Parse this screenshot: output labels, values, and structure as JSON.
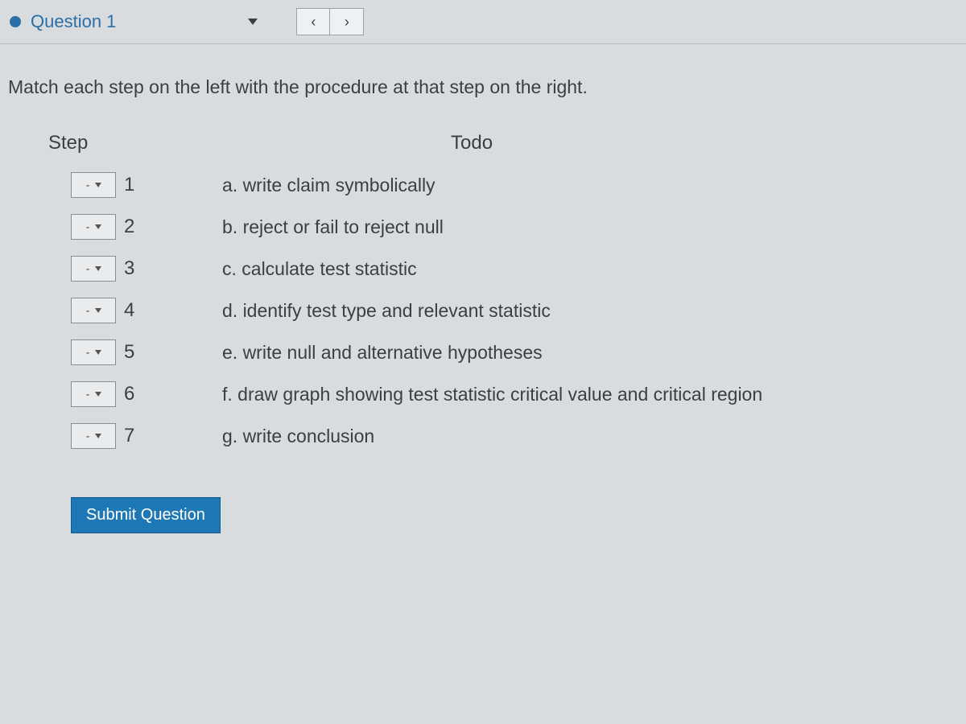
{
  "topbar": {
    "title": "Question 1",
    "prev": "‹",
    "next": "›"
  },
  "instruction": "Match each step on the left with the procedure at that step on the right.",
  "columns": {
    "step": "Step",
    "todo": "Todo"
  },
  "dropdown_placeholder": "-",
  "rows": [
    {
      "num": "1",
      "todo": "a. write claim symbolically"
    },
    {
      "num": "2",
      "todo": "b. reject or fail to reject null"
    },
    {
      "num": "3",
      "todo": "c. calculate test statistic"
    },
    {
      "num": "4",
      "todo": "d. identify test type and relevant statistic"
    },
    {
      "num": "5",
      "todo": "e. write null and alternative hypotheses"
    },
    {
      "num": "6",
      "todo": "f. draw graph showing test statistic critical value and critical region"
    },
    {
      "num": "7",
      "todo": "g. write conclusion"
    }
  ],
  "submit_label": "Submit Question"
}
